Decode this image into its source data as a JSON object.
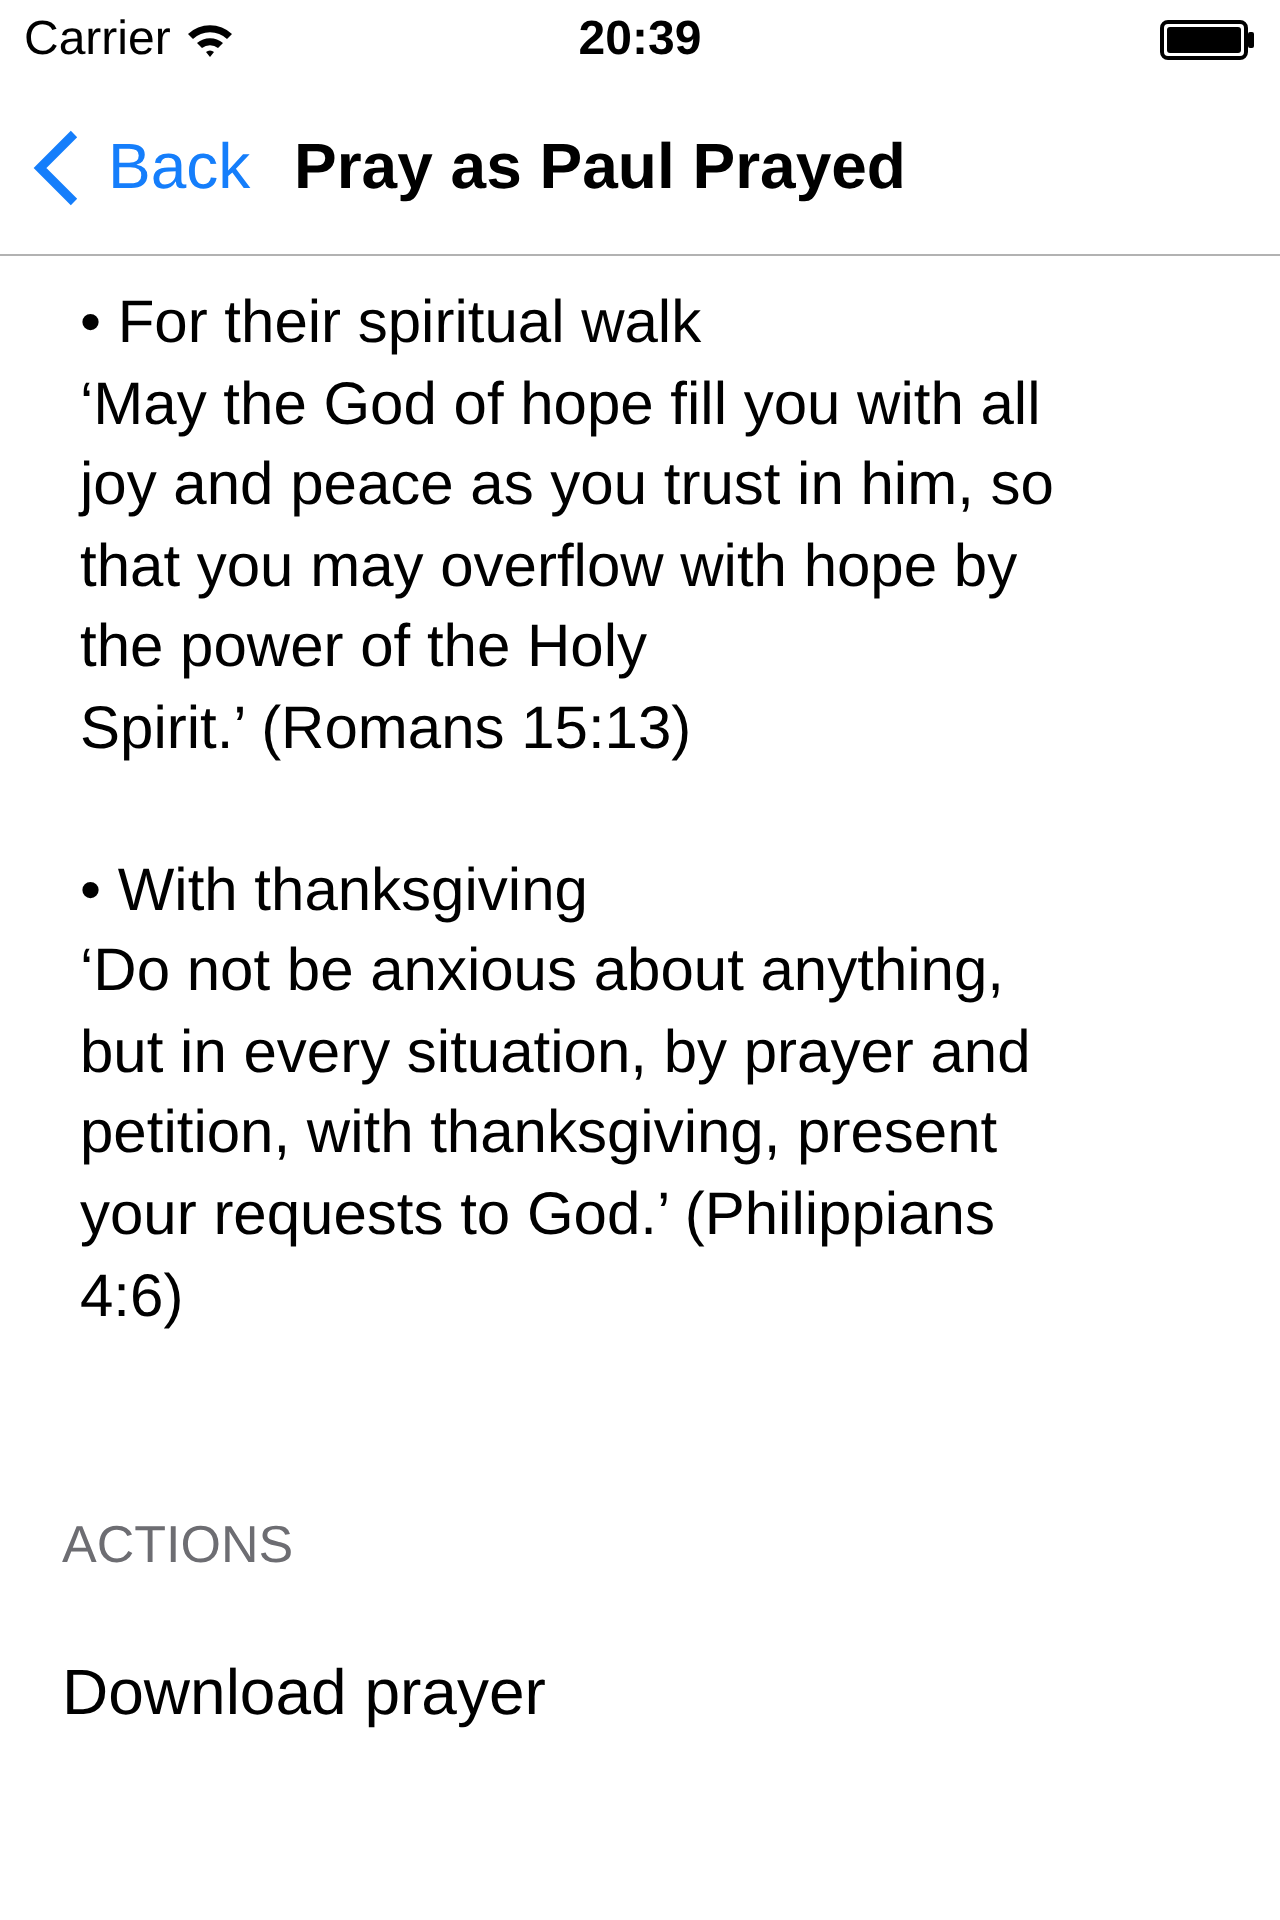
{
  "status_bar": {
    "carrier": "Carrier",
    "time": "20:39"
  },
  "nav_bar": {
    "back": "Back",
    "title": "Pray as Paul Prayed"
  },
  "sections": [
    {
      "heading": "• For their spiritual walk",
      "verse": "‘May the God of hope fill you with all\njoy and peace as you trust in him, so\nthat you may overflow with hope by\nthe power of the Holy\nSpirit.’ (Romans 15:13)"
    },
    {
      "heading": "• With thanksgiving",
      "verse": "‘Do not be anxious about anything,\nbut in every situation, by prayer and\npetition, with thanksgiving, present\nyour requests to God.’ (Philippians\n4:6)"
    }
  ],
  "actions": {
    "header": "ACTIONS",
    "items": [
      "Download prayer"
    ]
  }
}
